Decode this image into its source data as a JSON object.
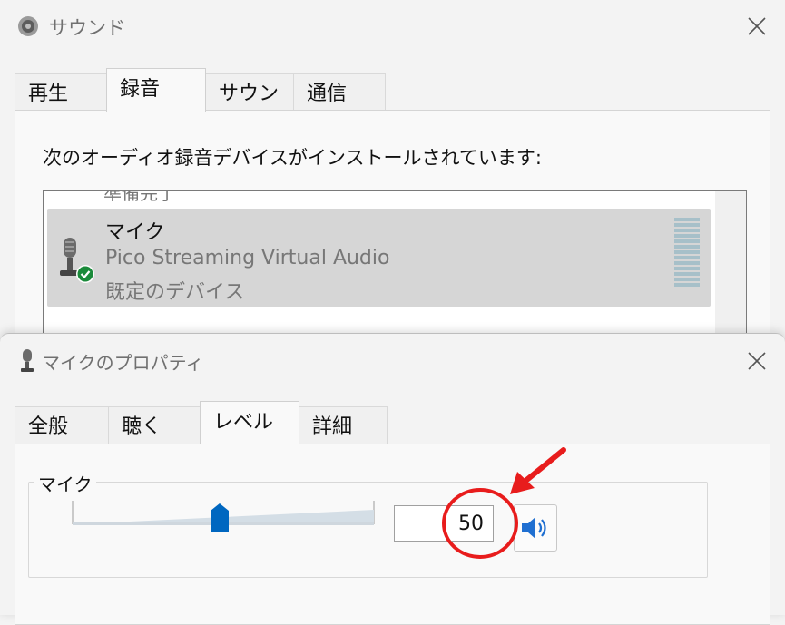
{
  "sound_window": {
    "title": "サウンド",
    "tabs": [
      "再生",
      "録音",
      "サウンド",
      "通信"
    ],
    "active_tab": "録音",
    "instruction": "次のオーディオ録音デバイスがインストールされています:",
    "partial_item": "準備完了",
    "device": {
      "name": "マイク",
      "description": "Pico Streaming Virtual Audio",
      "status": "既定のデバイス",
      "icon": "microphone-icon",
      "badge_icon": "default-check-icon"
    }
  },
  "props_window": {
    "title": "マイクのプロパティ",
    "tabs": [
      "全般",
      "聴く",
      "レベル",
      "詳細"
    ],
    "active_tab": "レベル",
    "group_label": "マイク",
    "level_value": "50",
    "slider_level": 50,
    "mute_icon": "speaker-icon"
  },
  "colors": {
    "accent": "#0067c0",
    "annotation": "#e81c1c",
    "check_badge": "#1a8a3a",
    "meter": "#a7c0c9",
    "selection": "#d6d6d6"
  }
}
